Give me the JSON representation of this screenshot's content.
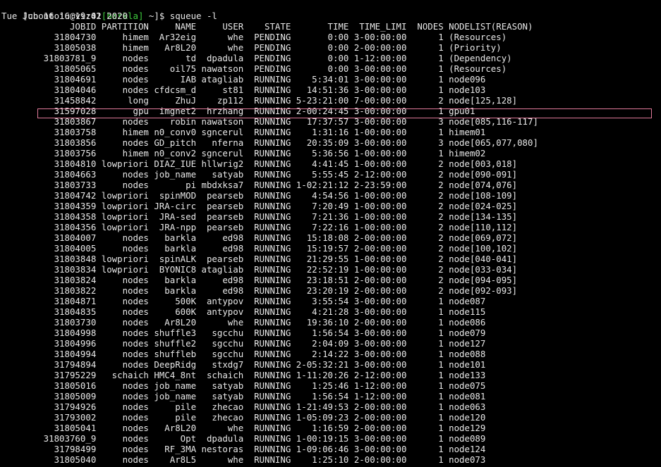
{
  "prompt": {
    "open": "[cbontoiu@viz01",
    "cluster": "[barkla]",
    "rest": " ~]$ squeue -l"
  },
  "date_line": "Tue Jun 16 16:19:42 2020",
  "columns": [
    "JOBID",
    "PARTITION",
    "NAME",
    "USER",
    "STATE",
    "TIME",
    "TIME_LIMI",
    "NODES",
    "NODELIST(REASON)"
  ],
  "highlight_color": "#e07a9a",
  "cluster_color": "#3fcf3f",
  "rows": [
    {
      "jobid": "31804730",
      "partition": "himem",
      "name": "Ar32eig",
      "user": "whe",
      "state": "PENDING",
      "time": "0:00",
      "limit": "3-00:00:00",
      "nodes": "1",
      "nodelist": "(Resources)"
    },
    {
      "jobid": "31805038",
      "partition": "himem",
      "name": "Ar8L20",
      "user": "whe",
      "state": "PENDING",
      "time": "0:00",
      "limit": "2-00:00:00",
      "nodes": "1",
      "nodelist": "(Priority)"
    },
    {
      "jobid": "31803781_9",
      "partition": "nodes",
      "name": "td",
      "user": "dpadula",
      "state": "PENDING",
      "time": "0:00",
      "limit": "1-12:00:00",
      "nodes": "1",
      "nodelist": "(Dependency)"
    },
    {
      "jobid": "31805065",
      "partition": "nodes",
      "name": "oil75",
      "user": "nawatson",
      "state": "PENDING",
      "time": "0:00",
      "limit": "3-00:00:00",
      "nodes": "1",
      "nodelist": "(Resources)"
    },
    {
      "jobid": "31804691",
      "partition": "nodes",
      "name": "IAB",
      "user": "atagliab",
      "state": "RUNNING",
      "time": "5:34:01",
      "limit": "3-00:00:00",
      "nodes": "1",
      "nodelist": "node096"
    },
    {
      "jobid": "31804046",
      "partition": "nodes",
      "name": "cfdcsm_d",
      "user": "st81",
      "state": "RUNNING",
      "time": "14:51:36",
      "limit": "3-00:00:00",
      "nodes": "1",
      "nodelist": "node103"
    },
    {
      "jobid": "31458842",
      "partition": "long",
      "name": "ZhuJ",
      "user": "zp112",
      "state": "RUNNING",
      "time": "5-23:21:00",
      "limit": "7-00:00:00",
      "nodes": "2",
      "nodelist": "node[125,128]"
    },
    {
      "jobid": "31597028",
      "partition": "gpu",
      "name": "imgnet2",
      "user": "hrzhang",
      "state": "RUNNING",
      "time": "2-00:24:45",
      "limit": "3-00:00:00",
      "nodes": "1",
      "nodelist": "gpu01"
    },
    {
      "jobid": "31803867",
      "partition": "nodes",
      "name": "robin",
      "user": "nawatson",
      "state": "RUNNING",
      "time": "17:37:57",
      "limit": "3-00:00:00",
      "nodes": "3",
      "nodelist": "node[085,116-117]"
    },
    {
      "jobid": "31803758",
      "partition": "himem",
      "name": "n0_conv0",
      "user": "sgncerul",
      "state": "RUNNING",
      "time": "1:31:16",
      "limit": "1-00:00:00",
      "nodes": "1",
      "nodelist": "himem01"
    },
    {
      "jobid": "31803856",
      "partition": "nodes",
      "name": "GD_pitch",
      "user": "nferna",
      "state": "RUNNING",
      "time": "20:35:09",
      "limit": "3-00:00:00",
      "nodes": "3",
      "nodelist": "node[065,077,080]"
    },
    {
      "jobid": "31803756",
      "partition": "himem",
      "name": "n0_conv2",
      "user": "sgncerul",
      "state": "RUNNING",
      "time": "5:36:56",
      "limit": "1-00:00:00",
      "nodes": "1",
      "nodelist": "himem02"
    },
    {
      "jobid": "31804810",
      "partition": "lowpriori",
      "name": "DIAZ_IUE",
      "user": "hllwrig2",
      "state": "RUNNING",
      "time": "4:41:45",
      "limit": "1-00:00:00",
      "nodes": "2",
      "nodelist": "node[003,018]"
    },
    {
      "jobid": "31804663",
      "partition": "nodes",
      "name": "job_name",
      "user": "satyab",
      "state": "RUNNING",
      "time": "5:55:45",
      "limit": "2-12:00:00",
      "nodes": "2",
      "nodelist": "node[090-091]"
    },
    {
      "jobid": "31803733",
      "partition": "nodes",
      "name": "pi",
      "user": "mbdxksa7",
      "state": "RUNNING",
      "time": "1-02:21:12",
      "limit": "2-23:59:00",
      "nodes": "2",
      "nodelist": "node[074,076]"
    },
    {
      "jobid": "31804742",
      "partition": "lowpriori",
      "name": "spinMOD",
      "user": "pearseb",
      "state": "RUNNING",
      "time": "4:54:56",
      "limit": "1-00:00:00",
      "nodes": "2",
      "nodelist": "node[108-109]"
    },
    {
      "jobid": "31804359",
      "partition": "lowpriori",
      "name": "JRA-circ",
      "user": "pearseb",
      "state": "RUNNING",
      "time": "7:20:49",
      "limit": "1-00:00:00",
      "nodes": "2",
      "nodelist": "node[024-025]"
    },
    {
      "jobid": "31804358",
      "partition": "lowpriori",
      "name": "JRA-sed",
      "user": "pearseb",
      "state": "RUNNING",
      "time": "7:21:36",
      "limit": "1-00:00:00",
      "nodes": "2",
      "nodelist": "node[134-135]"
    },
    {
      "jobid": "31804356",
      "partition": "lowpriori",
      "name": "JRA-npp",
      "user": "pearseb",
      "state": "RUNNING",
      "time": "7:22:16",
      "limit": "1-00:00:00",
      "nodes": "2",
      "nodelist": "node[110,112]"
    },
    {
      "jobid": "31804007",
      "partition": "nodes",
      "name": "barkla",
      "user": "ed98",
      "state": "RUNNING",
      "time": "15:18:08",
      "limit": "2-00:00:00",
      "nodes": "2",
      "nodelist": "node[069,072]"
    },
    {
      "jobid": "31804005",
      "partition": "nodes",
      "name": "barkla",
      "user": "ed98",
      "state": "RUNNING",
      "time": "15:19:57",
      "limit": "2-00:00:00",
      "nodes": "2",
      "nodelist": "node[100,102]"
    },
    {
      "jobid": "31803848",
      "partition": "lowpriori",
      "name": "spinALK",
      "user": "pearseb",
      "state": "RUNNING",
      "time": "21:29:55",
      "limit": "1-00:00:00",
      "nodes": "2",
      "nodelist": "node[040-041]"
    },
    {
      "jobid": "31803834",
      "partition": "lowpriori",
      "name": "BYONIC8",
      "user": "atagliab",
      "state": "RUNNING",
      "time": "22:52:19",
      "limit": "1-00:00:00",
      "nodes": "2",
      "nodelist": "node[033-034]"
    },
    {
      "jobid": "31803824",
      "partition": "nodes",
      "name": "barkla",
      "user": "ed98",
      "state": "RUNNING",
      "time": "23:18:51",
      "limit": "2-00:00:00",
      "nodes": "2",
      "nodelist": "node[094-095]"
    },
    {
      "jobid": "31803822",
      "partition": "nodes",
      "name": "barkla",
      "user": "ed98",
      "state": "RUNNING",
      "time": "23:20:19",
      "limit": "2-00:00:00",
      "nodes": "2",
      "nodelist": "node[092-093]"
    },
    {
      "jobid": "31804871",
      "partition": "nodes",
      "name": "500K",
      "user": "antypov",
      "state": "RUNNING",
      "time": "3:55:54",
      "limit": "3-00:00:00",
      "nodes": "1",
      "nodelist": "node087"
    },
    {
      "jobid": "31804835",
      "partition": "nodes",
      "name": "600K",
      "user": "antypov",
      "state": "RUNNING",
      "time": "4:21:28",
      "limit": "3-00:00:00",
      "nodes": "1",
      "nodelist": "node115"
    },
    {
      "jobid": "31803730",
      "partition": "nodes",
      "name": "Ar8L20",
      "user": "whe",
      "state": "RUNNING",
      "time": "19:36:10",
      "limit": "2-00:00:00",
      "nodes": "1",
      "nodelist": "node086"
    },
    {
      "jobid": "31804998",
      "partition": "nodes",
      "name": "shuffle3",
      "user": "sgcchu",
      "state": "RUNNING",
      "time": "1:56:54",
      "limit": "3-00:00:00",
      "nodes": "1",
      "nodelist": "node079"
    },
    {
      "jobid": "31804996",
      "partition": "nodes",
      "name": "shuffle2",
      "user": "sgcchu",
      "state": "RUNNING",
      "time": "2:04:09",
      "limit": "3-00:00:00",
      "nodes": "1",
      "nodelist": "node127"
    },
    {
      "jobid": "31804994",
      "partition": "nodes",
      "name": "shuffleb",
      "user": "sgcchu",
      "state": "RUNNING",
      "time": "2:14:22",
      "limit": "3-00:00:00",
      "nodes": "1",
      "nodelist": "node088"
    },
    {
      "jobid": "31794894",
      "partition": "nodes",
      "name": "DeepRidg",
      "user": "stxdg7",
      "state": "RUNNING",
      "time": "2-05:32:21",
      "limit": "3-00:00:00",
      "nodes": "1",
      "nodelist": "node101"
    },
    {
      "jobid": "31795229",
      "partition": "schaich",
      "name": "HMC4_8nt",
      "user": "schaich",
      "state": "RUNNING",
      "time": "1-11:20:26",
      "limit": "2-12:00:00",
      "nodes": "1",
      "nodelist": "node133"
    },
    {
      "jobid": "31805016",
      "partition": "nodes",
      "name": "job_name",
      "user": "satyab",
      "state": "RUNNING",
      "time": "1:25:46",
      "limit": "1-12:00:00",
      "nodes": "1",
      "nodelist": "node075"
    },
    {
      "jobid": "31805009",
      "partition": "nodes",
      "name": "job_name",
      "user": "satyab",
      "state": "RUNNING",
      "time": "1:56:54",
      "limit": "1-12:00:00",
      "nodes": "1",
      "nodelist": "node081"
    },
    {
      "jobid": "31794926",
      "partition": "nodes",
      "name": "pile",
      "user": "zhecao",
      "state": "RUNNING",
      "time": "1-21:49:53",
      "limit": "2-00:00:00",
      "nodes": "1",
      "nodelist": "node063"
    },
    {
      "jobid": "31793002",
      "partition": "nodes",
      "name": "pile",
      "user": "zhecao",
      "state": "RUNNING",
      "time": "1-05:09:23",
      "limit": "2-00:00:00",
      "nodes": "1",
      "nodelist": "node120"
    },
    {
      "jobid": "31805041",
      "partition": "nodes",
      "name": "Ar8L20",
      "user": "whe",
      "state": "RUNNING",
      "time": "1:16:59",
      "limit": "2-00:00:00",
      "nodes": "1",
      "nodelist": "node129"
    },
    {
      "jobid": "31803760_9",
      "partition": "nodes",
      "name": "Opt",
      "user": "dpadula",
      "state": "RUNNING",
      "time": "1-00:19:15",
      "limit": "3-00:00:00",
      "nodes": "1",
      "nodelist": "node089"
    },
    {
      "jobid": "31798499",
      "partition": "nodes",
      "name": "RF_3MA",
      "user": "nestoras",
      "state": "RUNNING",
      "time": "1-09:06:46",
      "limit": "3-00:00:00",
      "nodes": "1",
      "nodelist": "node124"
    },
    {
      "jobid": "31805040",
      "partition": "nodes",
      "name": "Ar8L5",
      "user": "whe",
      "state": "RUNNING",
      "time": "1:25:10",
      "limit": "2-00:00:00",
      "nodes": "1",
      "nodelist": "node073"
    }
  ]
}
